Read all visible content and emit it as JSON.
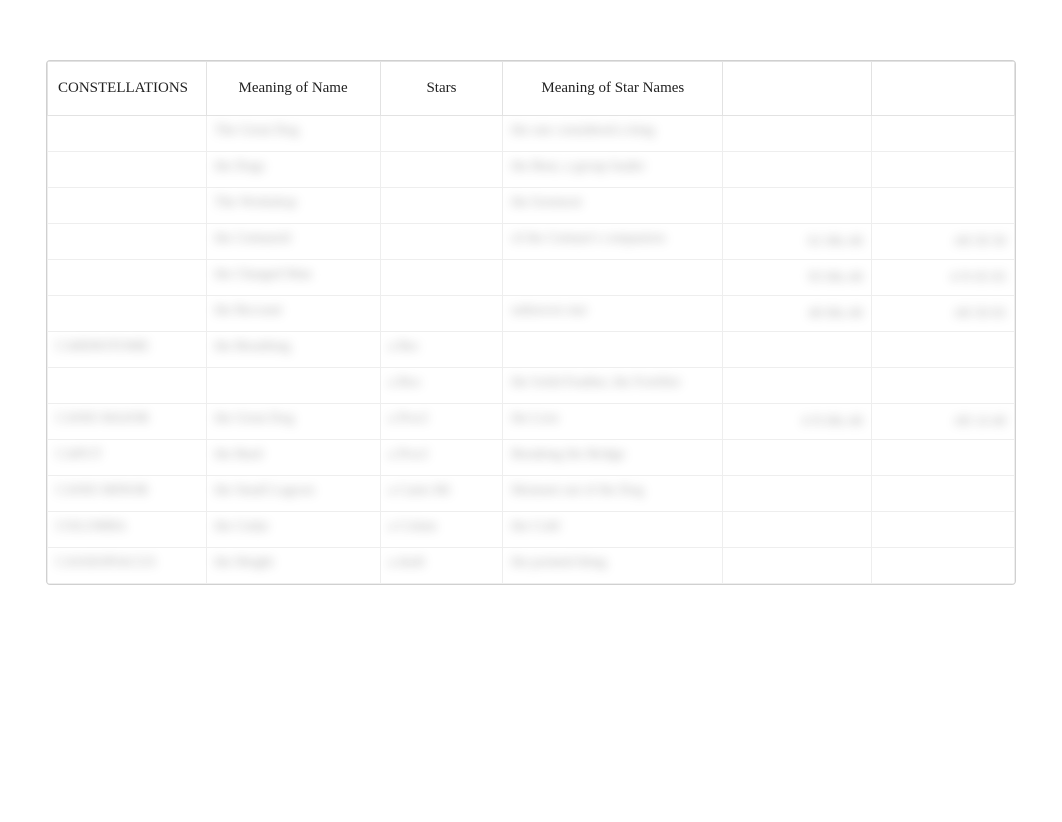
{
  "table": {
    "headers": [
      "CONSTELLATIONS",
      "Meaning of Name",
      "Stars",
      "Meaning of Star Names",
      "",
      ""
    ],
    "rows": [
      [
        "",
        "The Great Dog",
        "",
        "the one considered a king",
        "",
        ""
      ],
      [
        "",
        "the Dogs",
        "",
        "the Bear, a group leader",
        "",
        ""
      ],
      [
        "",
        "The Workshop",
        "",
        "the foremost",
        "",
        ""
      ],
      [
        "",
        "the Centaurid",
        "",
        "of the Centaur's companion",
        "61 00s 40",
        "-60 50 50"
      ],
      [
        "",
        "the Charged Man",
        "",
        "",
        "95 00s 40",
        "4 N 05 05"
      ],
      [
        "",
        "the Recount",
        "",
        "unknown star",
        "40 00s 40",
        "-60 50 05"
      ],
      [
        "CARDIOTOME",
        "the Breathing",
        "a Bsc",
        "",
        "",
        ""
      ],
      [
        "",
        "",
        "a Bos",
        "the Solid Feather, the Fortifier",
        "",
        ""
      ],
      [
        "CANIS MAJOR",
        "the Great Dog",
        "a Procl",
        "the Lion",
        "4 N 00s 40",
        "-60 14 40"
      ],
      [
        "CAPUT",
        "the Bard",
        "a Procl",
        "Breaking the Bridge",
        "",
        ""
      ],
      [
        "CANIS MINOR",
        "the Small Lagoon",
        "a Canis Mi",
        "Moment out of the Dog",
        "",
        ""
      ],
      [
        "COLUMBA",
        "the Cedar",
        "a Colum",
        "the Cold",
        "",
        ""
      ],
      [
        "CASSIOPIACUS",
        "the Height",
        "a draft",
        "the pointed thing",
        "",
        ""
      ]
    ]
  }
}
